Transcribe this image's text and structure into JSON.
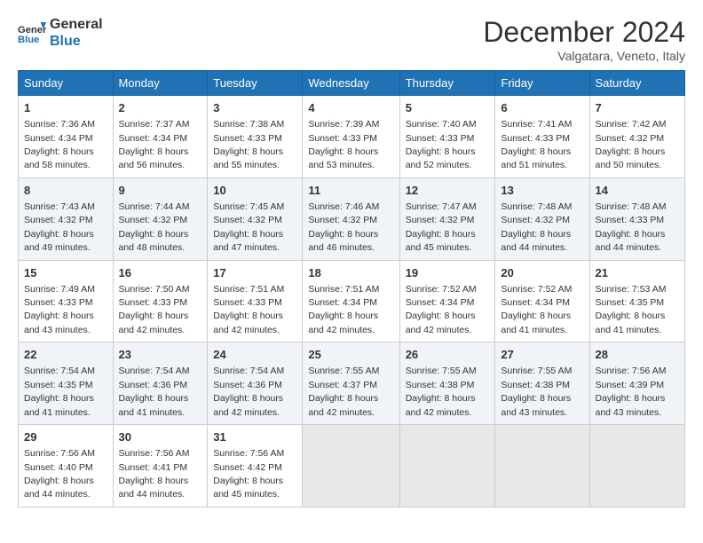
{
  "header": {
    "logo_line1": "General",
    "logo_line2": "Blue",
    "month_title": "December 2024",
    "subtitle": "Valgatara, Veneto, Italy"
  },
  "weekdays": [
    "Sunday",
    "Monday",
    "Tuesday",
    "Wednesday",
    "Thursday",
    "Friday",
    "Saturday"
  ],
  "weeks": [
    [
      {
        "day": "1",
        "sunrise": "7:36 AM",
        "sunset": "4:34 PM",
        "daylight": "8 hours and 58 minutes."
      },
      {
        "day": "2",
        "sunrise": "7:37 AM",
        "sunset": "4:34 PM",
        "daylight": "8 hours and 56 minutes."
      },
      {
        "day": "3",
        "sunrise": "7:38 AM",
        "sunset": "4:33 PM",
        "daylight": "8 hours and 55 minutes."
      },
      {
        "day": "4",
        "sunrise": "7:39 AM",
        "sunset": "4:33 PM",
        "daylight": "8 hours and 53 minutes."
      },
      {
        "day": "5",
        "sunrise": "7:40 AM",
        "sunset": "4:33 PM",
        "daylight": "8 hours and 52 minutes."
      },
      {
        "day": "6",
        "sunrise": "7:41 AM",
        "sunset": "4:33 PM",
        "daylight": "8 hours and 51 minutes."
      },
      {
        "day": "7",
        "sunrise": "7:42 AM",
        "sunset": "4:32 PM",
        "daylight": "8 hours and 50 minutes."
      }
    ],
    [
      {
        "day": "8",
        "sunrise": "7:43 AM",
        "sunset": "4:32 PM",
        "daylight": "8 hours and 49 minutes."
      },
      {
        "day": "9",
        "sunrise": "7:44 AM",
        "sunset": "4:32 PM",
        "daylight": "8 hours and 48 minutes."
      },
      {
        "day": "10",
        "sunrise": "7:45 AM",
        "sunset": "4:32 PM",
        "daylight": "8 hours and 47 minutes."
      },
      {
        "day": "11",
        "sunrise": "7:46 AM",
        "sunset": "4:32 PM",
        "daylight": "8 hours and 46 minutes."
      },
      {
        "day": "12",
        "sunrise": "7:47 AM",
        "sunset": "4:32 PM",
        "daylight": "8 hours and 45 minutes."
      },
      {
        "day": "13",
        "sunrise": "7:48 AM",
        "sunset": "4:32 PM",
        "daylight": "8 hours and 44 minutes."
      },
      {
        "day": "14",
        "sunrise": "7:48 AM",
        "sunset": "4:33 PM",
        "daylight": "8 hours and 44 minutes."
      }
    ],
    [
      {
        "day": "15",
        "sunrise": "7:49 AM",
        "sunset": "4:33 PM",
        "daylight": "8 hours and 43 minutes."
      },
      {
        "day": "16",
        "sunrise": "7:50 AM",
        "sunset": "4:33 PM",
        "daylight": "8 hours and 42 minutes."
      },
      {
        "day": "17",
        "sunrise": "7:51 AM",
        "sunset": "4:33 PM",
        "daylight": "8 hours and 42 minutes."
      },
      {
        "day": "18",
        "sunrise": "7:51 AM",
        "sunset": "4:34 PM",
        "daylight": "8 hours and 42 minutes."
      },
      {
        "day": "19",
        "sunrise": "7:52 AM",
        "sunset": "4:34 PM",
        "daylight": "8 hours and 42 minutes."
      },
      {
        "day": "20",
        "sunrise": "7:52 AM",
        "sunset": "4:34 PM",
        "daylight": "8 hours and 41 minutes."
      },
      {
        "day": "21",
        "sunrise": "7:53 AM",
        "sunset": "4:35 PM",
        "daylight": "8 hours and 41 minutes."
      }
    ],
    [
      {
        "day": "22",
        "sunrise": "7:54 AM",
        "sunset": "4:35 PM",
        "daylight": "8 hours and 41 minutes."
      },
      {
        "day": "23",
        "sunrise": "7:54 AM",
        "sunset": "4:36 PM",
        "daylight": "8 hours and 41 minutes."
      },
      {
        "day": "24",
        "sunrise": "7:54 AM",
        "sunset": "4:36 PM",
        "daylight": "8 hours and 42 minutes."
      },
      {
        "day": "25",
        "sunrise": "7:55 AM",
        "sunset": "4:37 PM",
        "daylight": "8 hours and 42 minutes."
      },
      {
        "day": "26",
        "sunrise": "7:55 AM",
        "sunset": "4:38 PM",
        "daylight": "8 hours and 42 minutes."
      },
      {
        "day": "27",
        "sunrise": "7:55 AM",
        "sunset": "4:38 PM",
        "daylight": "8 hours and 43 minutes."
      },
      {
        "day": "28",
        "sunrise": "7:56 AM",
        "sunset": "4:39 PM",
        "daylight": "8 hours and 43 minutes."
      }
    ],
    [
      {
        "day": "29",
        "sunrise": "7:56 AM",
        "sunset": "4:40 PM",
        "daylight": "8 hours and 44 minutes."
      },
      {
        "day": "30",
        "sunrise": "7:56 AM",
        "sunset": "4:41 PM",
        "daylight": "8 hours and 44 minutes."
      },
      {
        "day": "31",
        "sunrise": "7:56 AM",
        "sunset": "4:42 PM",
        "daylight": "8 hours and 45 minutes."
      },
      null,
      null,
      null,
      null
    ]
  ],
  "labels": {
    "sunrise": "Sunrise:",
    "sunset": "Sunset:",
    "daylight": "Daylight:"
  }
}
